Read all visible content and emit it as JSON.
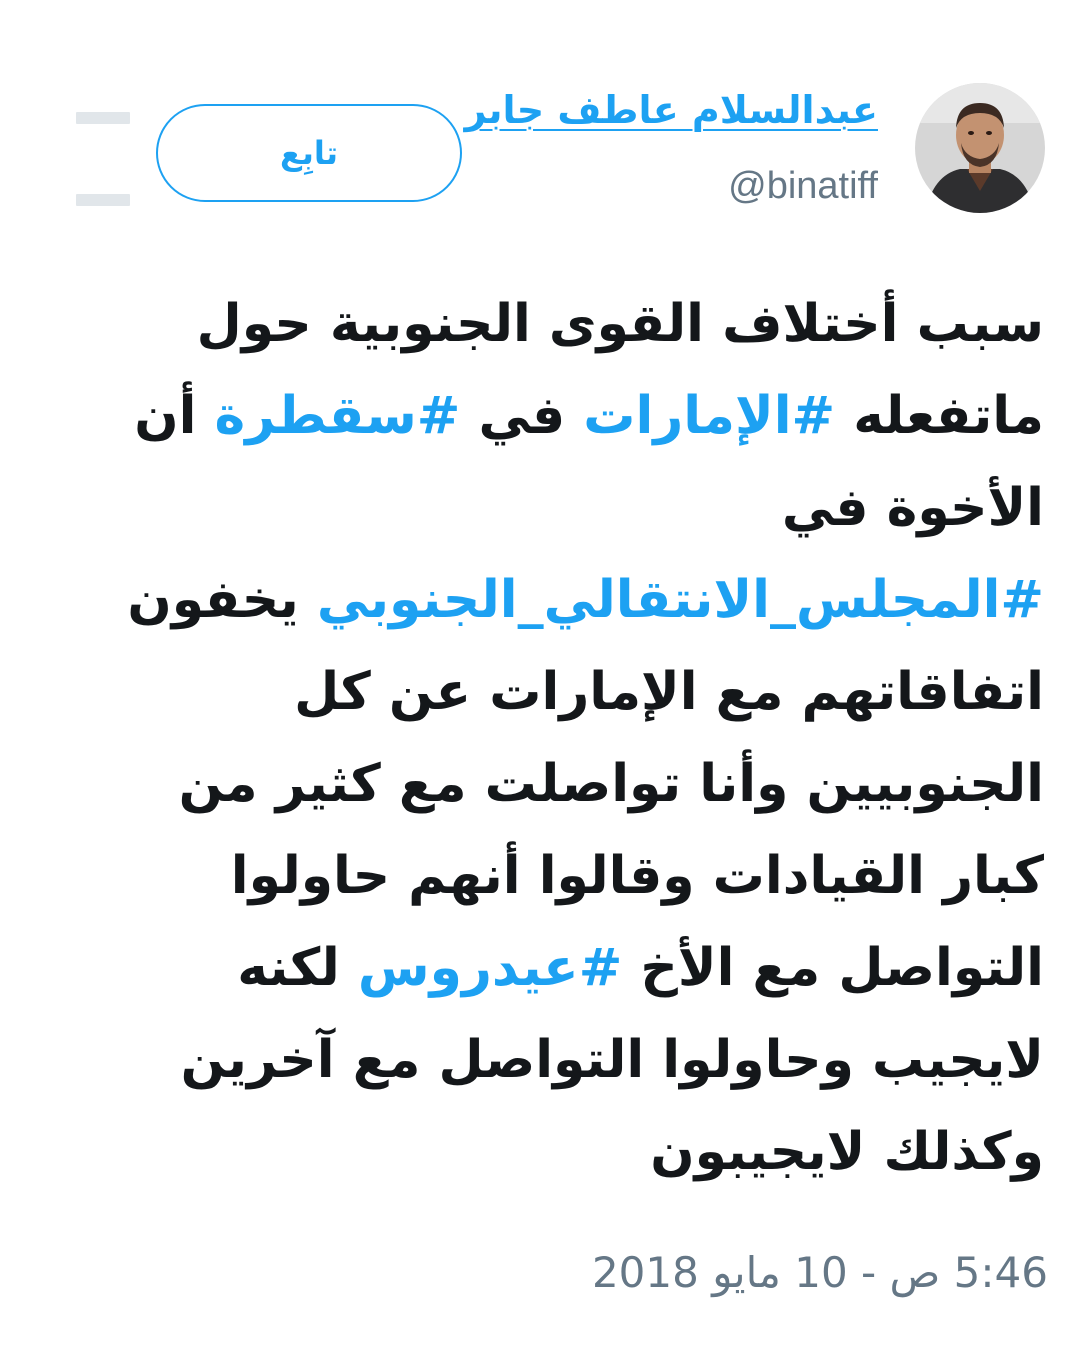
{
  "author": {
    "display_name": "عبدالسلام عاطف جابر",
    "handle": "@binatiff"
  },
  "follow_button": {
    "label": "تابِع"
  },
  "tweet": {
    "line1": "سبب أختلاف القوى الجنوبية حول",
    "line2_text": "ماتفعله ",
    "line2_tag1": "#الإمارات",
    "line2_mid": " في ",
    "line2_tag2": "#سقطرة",
    "line2_end": " أن",
    "line3": "الأخوة في",
    "line4_tag": "#المجلس_الانتقالي_الجنوبي",
    "line4_end": " يخفون",
    "line5": "اتفاقاتهم مع الإمارات عن كل",
    "line6": "الجنوبيين وأنا تواصلت مع كثير من",
    "line7": "كبار القيادات وقالوا أنهم حاولوا",
    "line8_text": "التواصل مع الأخ ",
    "line8_tag": "#عيدروس",
    "line8_end": " لكنه",
    "line9": "لايجيب وحاولوا التواصل مع آخرين",
    "line10": "وكذلك لايجيبون"
  },
  "timestamp": "5:46 ص - 10 مايو 2018",
  "colors": {
    "accent": "#1da1f2",
    "text": "#14171a",
    "muted": "#657786",
    "icon": "#e1e6ea"
  }
}
